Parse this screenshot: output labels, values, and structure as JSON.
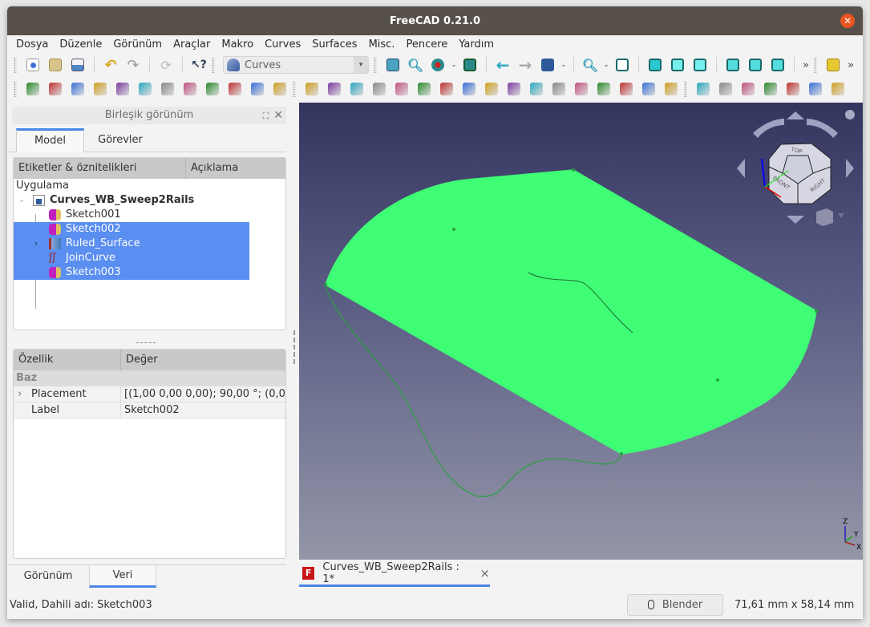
{
  "window": {
    "title": "FreeCAD 0.21.0",
    "close_icon": "close-icon"
  },
  "menu": [
    {
      "label": "Dosya",
      "mnemonic": "D"
    },
    {
      "label": "Düzenle",
      "mnemonic": "e"
    },
    {
      "label": "Görünüm",
      "mnemonic": "G"
    },
    {
      "label": "Araçlar",
      "mnemonic": ""
    },
    {
      "label": "Makro",
      "mnemonic": "M"
    },
    {
      "label": "Curves",
      "mnemonic": ""
    },
    {
      "label": "Surfaces",
      "mnemonic": ""
    },
    {
      "label": "Misc.",
      "mnemonic": ""
    },
    {
      "label": "Pencere",
      "mnemonic": "P"
    },
    {
      "label": "Yardım",
      "mnemonic": "Y"
    }
  ],
  "toolbar1": {
    "workbench_selector": "Curves",
    "overflow_label": "»",
    "file_icons": [
      "new-document-icon",
      "open-icon",
      "save-icon"
    ],
    "edit_icons": [
      "undo-icon",
      "redo-icon",
      "refresh-icon",
      "whats-this-icon"
    ],
    "view_icons": [
      "fit-all-icon",
      "fit-selection-icon",
      "draw-style-icon",
      "bounding-box-icon",
      "back-icon",
      "forward-icon",
      "workbench-view-icon",
      "zoom-icon",
      "isometric-icon",
      "front-view-icon",
      "top-view-icon",
      "right-view-icon",
      "rear-view-icon",
      "bottom-view-icon",
      "left-view-icon"
    ],
    "extra_icons": [
      "part-icon"
    ]
  },
  "toolbar2": {
    "curves_icons": [
      "line-icon",
      "curve-icon",
      "sketch-on-surface-icon",
      "join-curve-icon",
      "split-curve-icon",
      "discretize-icon",
      "approximate-icon",
      "interpolate-icon",
      "segment-icon",
      "blend-curve-icon",
      "comb-icon",
      "surface-icon"
    ],
    "surfaces_icons": [
      "zebra-icon",
      "gordon-icon",
      "pipe-shell-icon",
      "sweep-icon",
      "extend-icon",
      "blend-surface-icon",
      "pipe-icon",
      "sweep2rails-icon",
      "ruled-surface-icon",
      "flatten-icon",
      "knot-icon",
      "sphere-icon",
      "trim-face-icon",
      "iso-curve-icon",
      "map-on-face-icon",
      "split-face-icon",
      "reflect-icon"
    ],
    "misc_icons": [
      "info-icon",
      "box-icon",
      "solid-icon",
      "nurbs-icon",
      "multi-select-icon",
      "grid-icon",
      "control-points-icon"
    ]
  },
  "combo_view": {
    "title": "Birleşik görünüm",
    "tabs": [
      "Model",
      "Görevler"
    ],
    "active_tab": "Model",
    "tree_headers": [
      "Etiketler & öznitelikleri",
      "Açıklama"
    ],
    "root_label": "Uygulama",
    "document": "Curves_WB_Sweep2Rails",
    "items": [
      {
        "label": "Sketch001",
        "icon": "sketch-icon",
        "selected": false
      },
      {
        "label": "Sketch002",
        "icon": "sketch-icon",
        "selected": true
      },
      {
        "label": "Ruled_Surface",
        "icon": "ruled-surface-icon",
        "selected": true,
        "expandable": true
      },
      {
        "label": "JoinCurve",
        "icon": "join-curve-icon",
        "selected": true
      },
      {
        "label": "Sketch003",
        "icon": "sketch-icon",
        "selected": true
      }
    ],
    "splitter": "-----"
  },
  "properties": {
    "headers": [
      "Özellik",
      "Değer"
    ],
    "group": "Baz",
    "rows": [
      {
        "name": "Placement",
        "value": "[(1,00 0,00 0,00); 90,00 °; (0,0...",
        "expandable": true
      },
      {
        "name": "Label",
        "value": "Sketch002"
      }
    ],
    "bottom_tabs": [
      "Görünüm",
      "Veri"
    ],
    "active_bottom_tab": "Veri"
  },
  "viewport": {
    "surface_color": "#3ffe75",
    "edge_color": "#2aa040",
    "navcube_faces": [
      "TOP",
      "FRONT",
      "RIGHT"
    ],
    "axis_labels": [
      "Z",
      "Y",
      "X"
    ]
  },
  "document_tab": {
    "label": "Curves_WB_Sweep2Rails : 1*",
    "close": "×"
  },
  "status": {
    "message": "Valid, Dahili adı: Sketch003",
    "navigation_style": "Blender",
    "dimensions": "71,61 mm x 58,14 mm"
  }
}
